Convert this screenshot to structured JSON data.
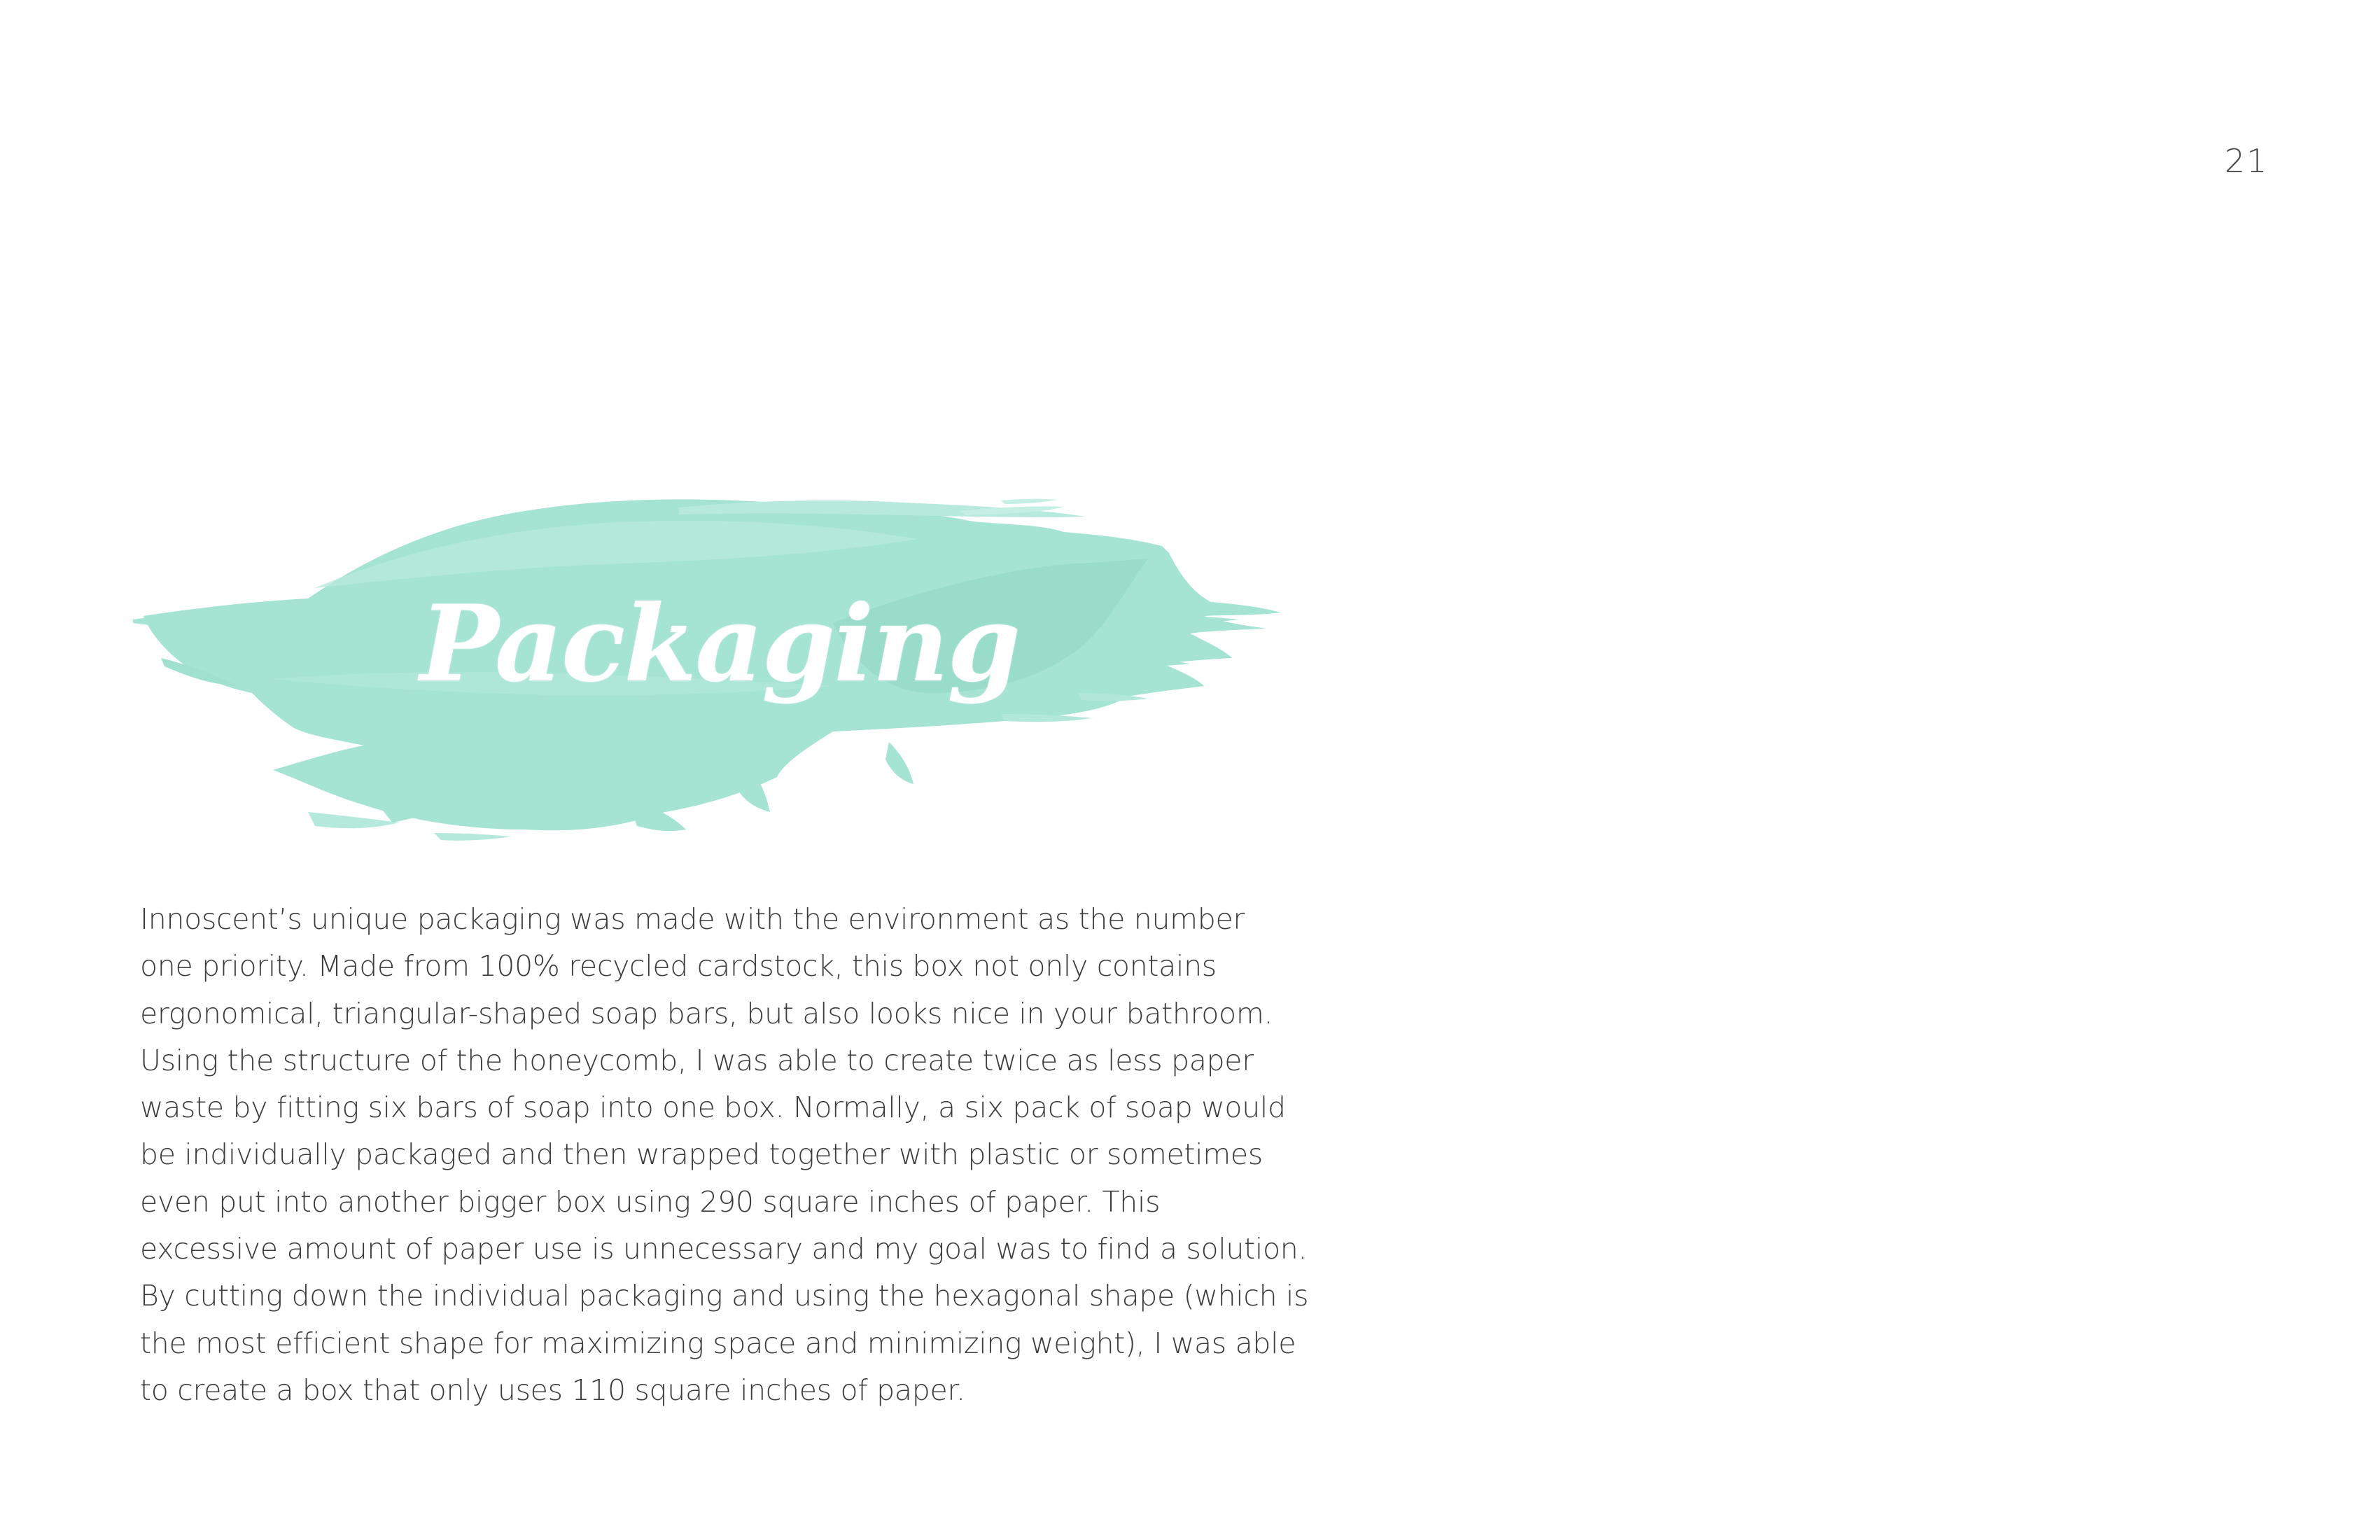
{
  "page": {
    "number": "21"
  },
  "title": {
    "text": "Packaging",
    "brush_color": "#a5e3d3",
    "brush_color_light": "#b9ebde",
    "brush_color_dark": "#96dcc9",
    "text_color": "#ffffff"
  },
  "body": {
    "lines": [
      "Innoscent’s unique packaging was made with the environment as the number",
      "one priority. Made from 100% recycled cardstock, this box not only contains",
      "ergonomical, triangular-shaped soap bars, but also looks nice in your bathroom.",
      "Using the structure of the honeycomb, I was able to create twice as less paper",
      "waste by fitting six bars of soap into one box. Normally, a six pack of soap would",
      "be individually packaged and then wrapped together with plastic or sometimes",
      "even put into another bigger box using 290 square inches of paper. This",
      "excessive amount of paper use is unnecessary and my goal was to find a solution.",
      "By cutting down the individual packaging and using the hexagonal shape (which is",
      "the most efficient shape for maximizing space and minimizing weight), I was able",
      "to create a box that only uses 110 square inches of paper."
    ]
  }
}
